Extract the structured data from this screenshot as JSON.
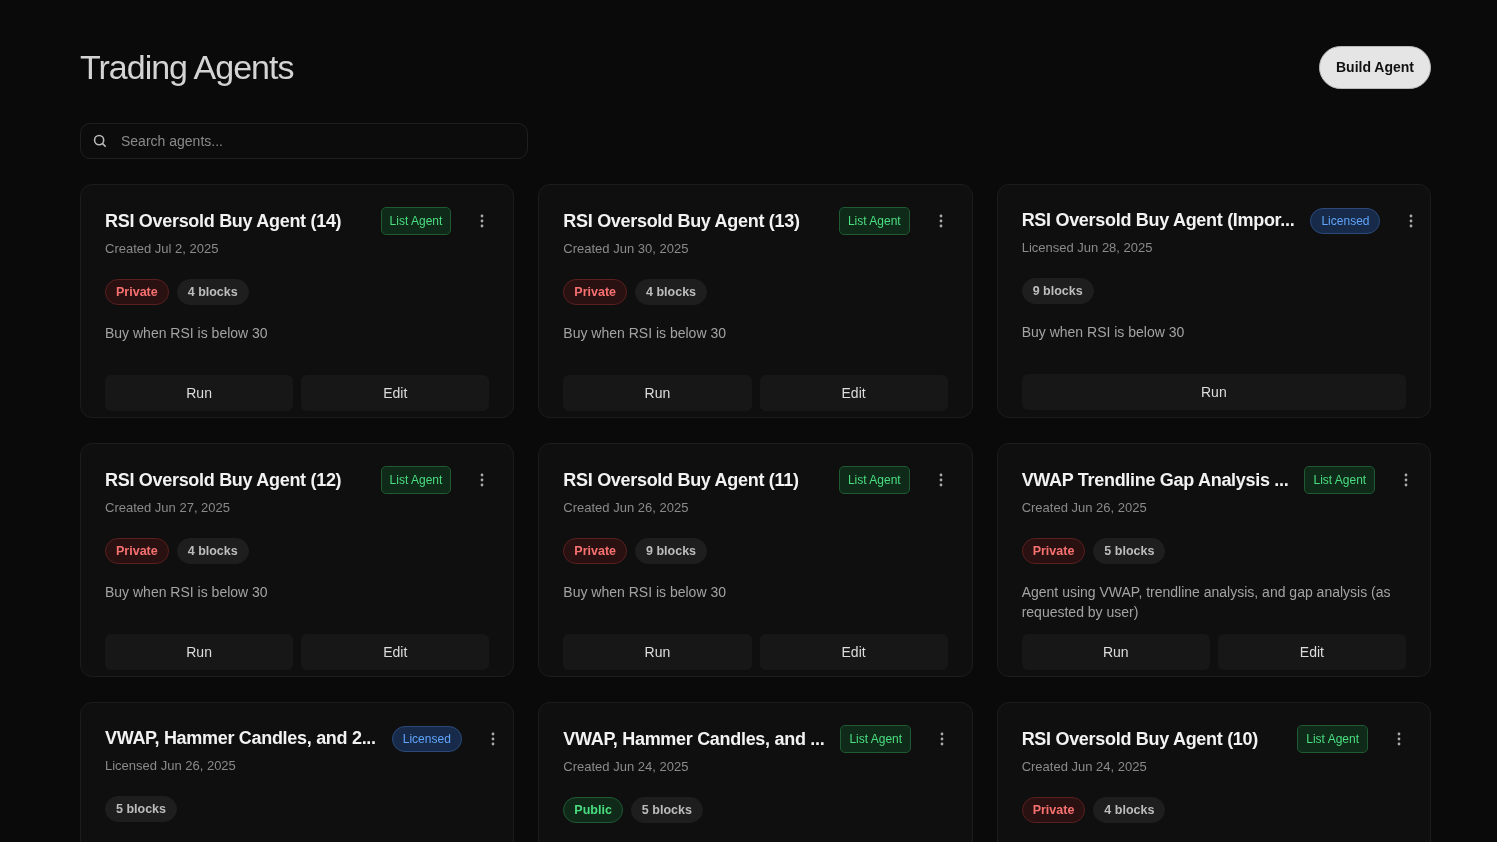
{
  "page": {
    "title": "Trading Agents",
    "build_button": "Build Agent"
  },
  "search": {
    "placeholder": "Search agents..."
  },
  "agents": [
    {
      "name": "RSI Oversold Buy Agent (14)",
      "badge": {
        "kind": "list",
        "label": "List Agent"
      },
      "date": "Created Jul 2, 2025",
      "visibility": {
        "kind": "private",
        "label": "Private"
      },
      "blocks": "4 blocks",
      "description": "Buy when RSI is below 30",
      "buttons": [
        "Run",
        "Edit"
      ]
    },
    {
      "name": "RSI Oversold Buy Agent (13)",
      "badge": {
        "kind": "list",
        "label": "List Agent"
      },
      "date": "Created Jun 30, 2025",
      "visibility": {
        "kind": "private",
        "label": "Private"
      },
      "blocks": "4 blocks",
      "description": "Buy when RSI is below 30",
      "buttons": [
        "Run",
        "Edit"
      ]
    },
    {
      "name": "RSI Oversold Buy Agent (Impor...",
      "badge": {
        "kind": "licensed",
        "label": "Licensed"
      },
      "date": "Licensed Jun 28, 2025",
      "blocks": "9 blocks",
      "description": "Buy when RSI is below 30",
      "buttons": [
        "Run"
      ]
    },
    {
      "name": "RSI Oversold Buy Agent (12)",
      "badge": {
        "kind": "list",
        "label": "List Agent"
      },
      "date": "Created Jun 27, 2025",
      "visibility": {
        "kind": "private",
        "label": "Private"
      },
      "blocks": "4 blocks",
      "description": "Buy when RSI is below 30",
      "buttons": [
        "Run",
        "Edit"
      ]
    },
    {
      "name": "RSI Oversold Buy Agent (11)",
      "badge": {
        "kind": "list",
        "label": "List Agent"
      },
      "date": "Created Jun 26, 2025",
      "visibility": {
        "kind": "private",
        "label": "Private"
      },
      "blocks": "9 blocks",
      "description": "Buy when RSI is below 30",
      "buttons": [
        "Run",
        "Edit"
      ]
    },
    {
      "name": "VWAP Trendline Gap Analysis ...",
      "badge": {
        "kind": "list",
        "label": "List Agent"
      },
      "date": "Created Jun 26, 2025",
      "visibility": {
        "kind": "private",
        "label": "Private"
      },
      "blocks": "5 blocks",
      "description": "Agent using VWAP, trendline analysis, and gap analysis (as requested by user)",
      "buttons": [
        "Run",
        "Edit"
      ]
    },
    {
      "name": "VWAP, Hammer Candles, and 2...",
      "badge": {
        "kind": "licensed",
        "label": "Licensed"
      },
      "date": "Licensed Jun 26, 2025",
      "blocks": "5 blocks"
    },
    {
      "name": "VWAP, Hammer Candles, and ...",
      "badge": {
        "kind": "list",
        "label": "List Agent"
      },
      "date": "Created Jun 24, 2025",
      "visibility": {
        "kind": "public",
        "label": "Public"
      },
      "blocks": "5 blocks"
    },
    {
      "name": "RSI Oversold Buy Agent (10)",
      "badge": {
        "kind": "list",
        "label": "List Agent"
      },
      "date": "Created Jun 24, 2025",
      "visibility": {
        "kind": "private",
        "label": "Private"
      },
      "blocks": "4 blocks"
    }
  ]
}
